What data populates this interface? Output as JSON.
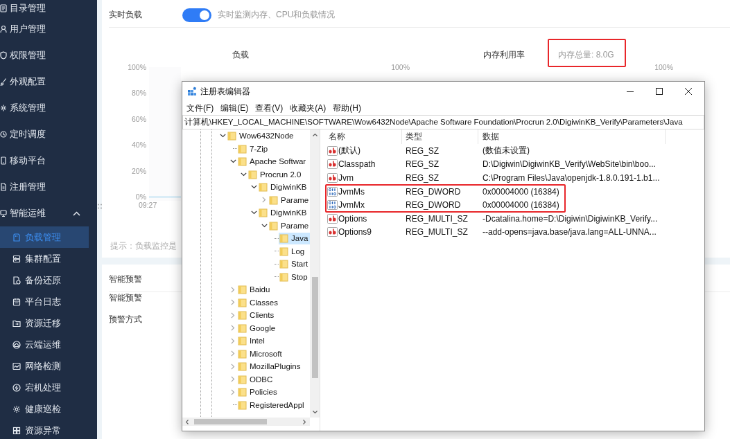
{
  "sidebar": {
    "items": [
      {
        "label": "目录管理",
        "selected": false
      },
      {
        "label": "用户管理",
        "selected": false
      },
      {
        "label": "权限管理",
        "selected": false
      },
      {
        "label": "外观配置",
        "selected": false
      },
      {
        "label": "系统管理",
        "selected": false
      },
      {
        "label": "定时调度",
        "selected": false
      },
      {
        "label": "移动平台",
        "selected": false
      },
      {
        "label": "注册管理",
        "selected": false
      },
      {
        "label": "智能运维",
        "selected": false,
        "expanded": true,
        "children": [
          {
            "label": "负载管理",
            "selected": true
          },
          {
            "label": "集群配置",
            "selected": false
          },
          {
            "label": "备份还原",
            "selected": false
          },
          {
            "label": "平台日志",
            "selected": false
          },
          {
            "label": "资源迁移",
            "selected": false
          },
          {
            "label": "云端运维",
            "selected": false
          },
          {
            "label": "网络检测",
            "selected": false
          },
          {
            "label": "宕机处理",
            "selected": false
          },
          {
            "label": "健康巡检",
            "selected": false
          },
          {
            "label": "资源异常",
            "selected": false
          }
        ]
      }
    ]
  },
  "realtime_load": {
    "label": "实时负载",
    "toggle": {
      "on": true
    },
    "description": "实时监测内存、CPU和负载情况"
  },
  "charts": [
    {
      "title": "负载",
      "y_ticks": [
        "100%",
        "80%",
        "60%",
        "40%",
        "20%",
        "0%"
      ],
      "x_ticks": [
        "09:27"
      ]
    },
    {
      "title": "内存利用率",
      "note": {
        "text": "内存总量: 8.0G",
        "highlighted": true
      },
      "y_ticks": [
        "100%"
      ]
    },
    {
      "y_ticks": [
        "100%"
      ]
    }
  ],
  "hint": "提示：负载监控是",
  "smart_alert": {
    "title": "智能预警",
    "fields": [
      "智能预警",
      "预警方式"
    ]
  },
  "registry_editor": {
    "title": "注册表编辑器",
    "menu": [
      "文件(F)",
      "编辑(E)",
      "查看(V)",
      "收藏夹(A)",
      "帮助(H)"
    ],
    "address": "计算机\\HKEY_LOCAL_MACHINE\\SOFTWARE\\Wow6432Node\\Apache Software Foundation\\Procrun 2.0\\DigiwinKB_Verify\\Parameters\\Java",
    "tree": [
      {
        "label": "Wow6432Node",
        "expanded": true,
        "selected": false,
        "children": [
          {
            "label": "7-Zip",
            "selected": false
          },
          {
            "label": "Apache Softwar",
            "expanded": true,
            "selected": false,
            "children": [
              {
                "label": "Procrun 2.0",
                "expanded": true,
                "selected": false,
                "children": [
                  {
                    "label": "DigiwinKB",
                    "expanded": true,
                    "selected": false,
                    "children": [
                      {
                        "label": "Parame",
                        "expanded": false,
                        "selected": false
                      }
                    ]
                  },
                  {
                    "label": "DigiwinKB",
                    "expanded": true,
                    "selected": false,
                    "children": [
                      {
                        "label": "Parame",
                        "expanded": true,
                        "selected": false,
                        "children": [
                          {
                            "label": "Java",
                            "selected": true
                          },
                          {
                            "label": "Log",
                            "selected": false
                          },
                          {
                            "label": "Start",
                            "selected": false
                          },
                          {
                            "label": "Stop",
                            "selected": false
                          }
                        ]
                      }
                    ]
                  }
                ]
              }
            ]
          },
          {
            "label": "Baidu",
            "expanded": false,
            "selected": false
          },
          {
            "label": "Classes",
            "expanded": false,
            "selected": false
          },
          {
            "label": "Clients",
            "expanded": false,
            "selected": false
          },
          {
            "label": "Google",
            "expanded": false,
            "selected": false
          },
          {
            "label": "Intel",
            "expanded": false,
            "selected": false
          },
          {
            "label": "Microsoft",
            "expanded": false,
            "selected": false
          },
          {
            "label": "MozillaPlugins",
            "expanded": false,
            "selected": false
          },
          {
            "label": "ODBC",
            "expanded": false,
            "selected": false
          },
          {
            "label": "Policies",
            "expanded": false,
            "selected": false
          },
          {
            "label": "RegisteredAppl",
            "selected": false
          }
        ]
      }
    ],
    "columns": [
      "名称",
      "类型",
      "数据"
    ],
    "values": [
      {
        "kind": "string",
        "name": "(默认)",
        "type": "REG_SZ",
        "data": "(数值未设置)",
        "highlighted": false
      },
      {
        "kind": "string",
        "name": "Classpath",
        "type": "REG_SZ",
        "data": "D:\\Digiwin\\DigiwinKB_Verify\\WebSite\\bin\\boo...",
        "highlighted": false
      },
      {
        "kind": "string",
        "name": "Jvm",
        "type": "REG_SZ",
        "data": "C:\\Program Files\\Java\\openjdk-1.8.0.191-1.b1...",
        "highlighted": false
      },
      {
        "kind": "dword",
        "name": "JvmMs",
        "type": "REG_DWORD",
        "data": "0x00004000 (16384)",
        "highlighted": true
      },
      {
        "kind": "dword",
        "name": "JvmMx",
        "type": "REG_DWORD",
        "data": "0x00004000 (16384)",
        "highlighted": true
      },
      {
        "kind": "string",
        "name": "Options",
        "type": "REG_MULTI_SZ",
        "data": "-Dcatalina.home=D:\\Digiwin\\DigiwinKB_Verify...",
        "highlighted": false
      },
      {
        "kind": "string",
        "name": "Options9",
        "type": "REG_MULTI_SZ",
        "data": "--add-opens=java.base/java.lang=ALL-UNNA...",
        "highlighted": false
      }
    ]
  }
}
